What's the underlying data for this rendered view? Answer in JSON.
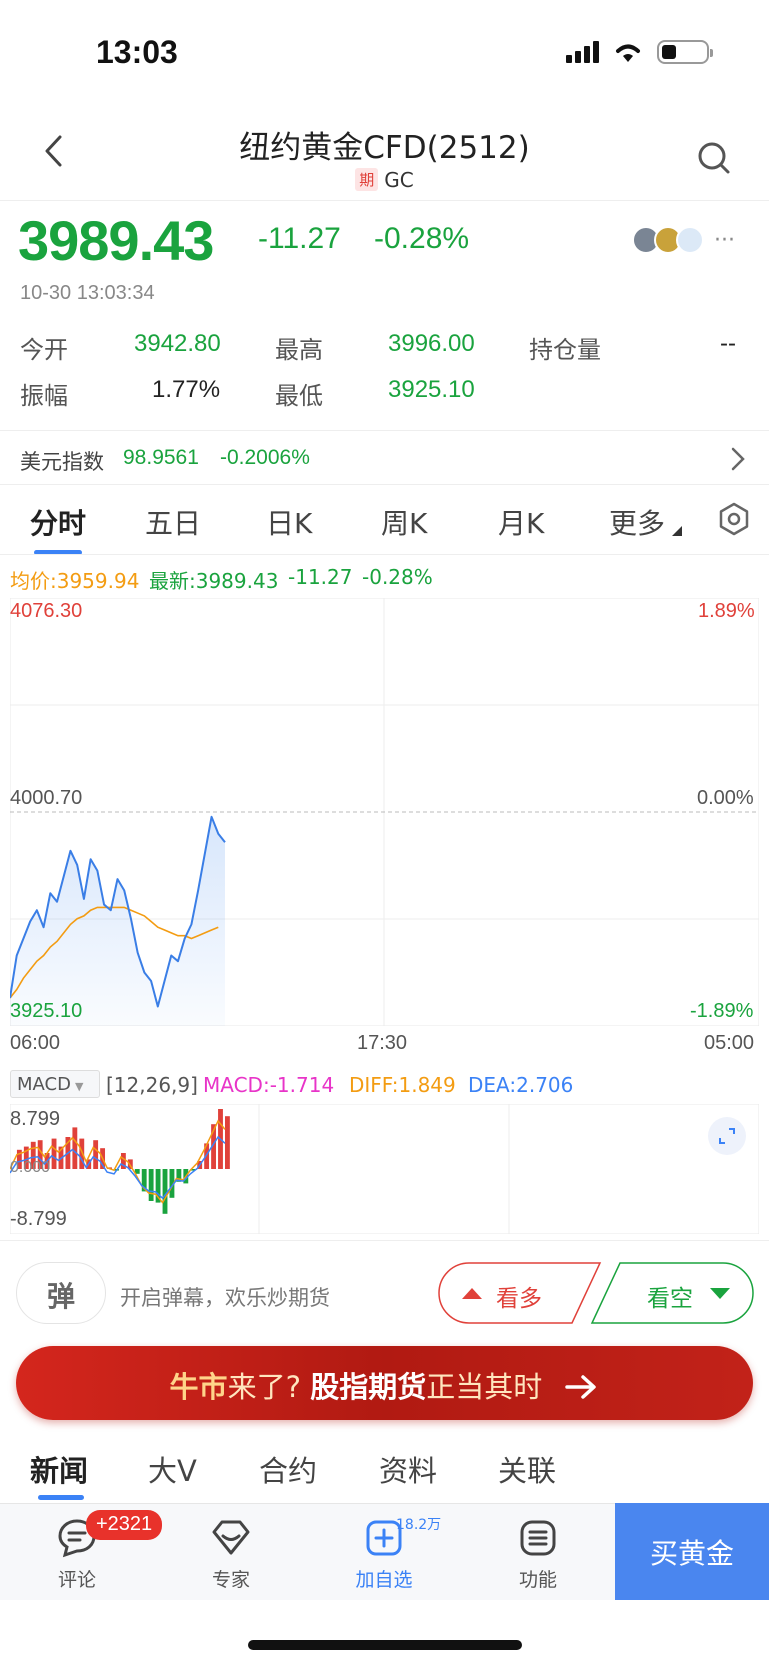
{
  "status": {
    "time": "13:03"
  },
  "header": {
    "title": "纽约黄金CFD(2512)",
    "tag": "期",
    "code": "GC"
  },
  "quote": {
    "price": "3989.43",
    "change": "-11.27",
    "change_pct": "-0.28%",
    "timestamp": "10-30 13:03:34"
  },
  "stats": [
    {
      "label": "今开",
      "value": "3942.80"
    },
    {
      "label": "最高",
      "value": "3996.00"
    },
    {
      "label": "持仓量",
      "value": "--"
    },
    {
      "label": "振幅",
      "value": "1.77%"
    },
    {
      "label": "最低",
      "value": "3925.10"
    }
  ],
  "index": {
    "label": "美元指数",
    "value": "98.9561",
    "change_pct": "-0.2006%"
  },
  "chart_tabs": [
    "分时",
    "五日",
    "日K",
    "周K",
    "月K",
    "更多"
  ],
  "chart_legend": {
    "avg_label": "均价:3959.94",
    "latest_label": "最新:3989.43",
    "change": "-11.27",
    "change_pct": "-0.28%"
  },
  "price_axis": {
    "top": "4076.30",
    "mid": "4000.70",
    "bottom": "3925.10",
    "top_pct": "1.89%",
    "mid_pct": "0.00%",
    "bottom_pct": "-1.89%",
    "time_start": "06:00",
    "time_mid": "17:30",
    "time_end": "05:00"
  },
  "macd": {
    "selector": "MACD",
    "params": "[12,26,9]",
    "macd_label": "MACD:-1.714",
    "diff_label": "DIFF:1.849",
    "dea_label": "DEA:2.706",
    "top": "8.799",
    "bottom": "-8.799",
    "mid": "0.000"
  },
  "actions": {
    "danmaku_icon": "弹",
    "danmaku_text": "开启弹幕，欢乐炒期货",
    "bull": "看多",
    "bear": "看空"
  },
  "banner": {
    "part1": "牛市",
    "part2": "来了?",
    "part3": "股指期货",
    "part4": "正当其时"
  },
  "news_tabs": [
    "新闻",
    "大V",
    "合约",
    "资料",
    "关联"
  ],
  "bottom_nav": {
    "comments": "评论",
    "comments_badge": "+2321",
    "experts": "专家",
    "watchlist": "加自选",
    "watchlist_count": "18.2万",
    "functions": "功能",
    "buy": "买黄金"
  },
  "chart_data": [
    {
      "type": "line",
      "title": "",
      "series": [
        {
          "name": "最新",
          "values": [
            3935,
            3950,
            3956,
            3962,
            3966,
            3960,
            3972,
            3969,
            3978,
            3987,
            3982,
            3970,
            3984,
            3980,
            3968,
            3966,
            3977,
            3973,
            3963,
            3951,
            3944,
            3941,
            3932,
            3941,
            3950,
            3948,
            3956,
            3961,
            3973,
            3986,
            3999,
            3993,
            3990
          ]
        },
        {
          "name": "均价",
          "values": [
            3935,
            3938,
            3942,
            3945,
            3948,
            3950,
            3953,
            3955,
            3958,
            3961,
            3963,
            3964,
            3966,
            3967,
            3967,
            3967,
            3967,
            3967,
            3966,
            3965,
            3964,
            3962,
            3960,
            3959,
            3958,
            3957,
            3957,
            3956,
            3957,
            3958,
            3959,
            3960
          ]
        }
      ],
      "ylim": [
        3925.1,
        4076.3
      ]
    }
  ]
}
